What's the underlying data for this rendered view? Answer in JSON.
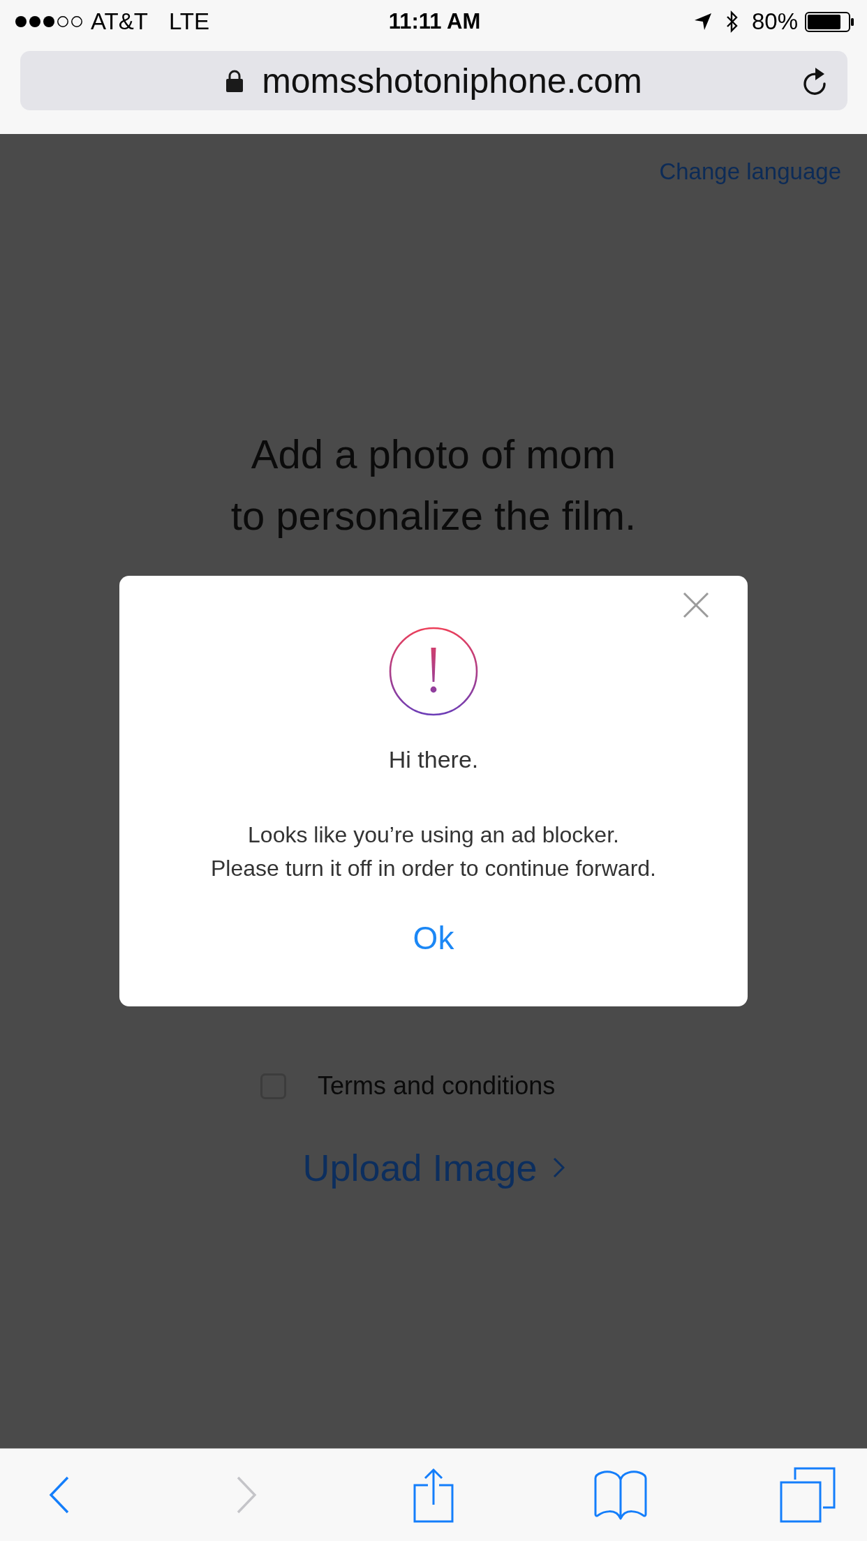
{
  "status_bar": {
    "carrier": "AT&T",
    "network": "LTE",
    "time": "11:11 AM",
    "battery": "80%"
  },
  "address_bar": {
    "domain": "momsshotoniphone.com"
  },
  "page": {
    "language_link": "Change language",
    "heading": [
      "Add a photo of mom",
      "to personalize the film."
    ],
    "terms": {
      "label": "Terms and conditions",
      "checked": false
    },
    "upload_link": "Upload Image"
  },
  "dialog": {
    "title": "Hi there.",
    "message": [
      "Looks like you’re using an ad blocker.",
      "Please turn it off in order to continue forward."
    ],
    "button": "Ok"
  },
  "toolbar": [
    {
      "kind": "back",
      "disabled": false
    },
    {
      "kind": "forward",
      "disabled": true
    },
    {
      "kind": "share",
      "disabled": false
    },
    {
      "kind": "bookmarks",
      "disabled": false
    },
    {
      "kind": "tabs",
      "disabled": false
    }
  ]
}
